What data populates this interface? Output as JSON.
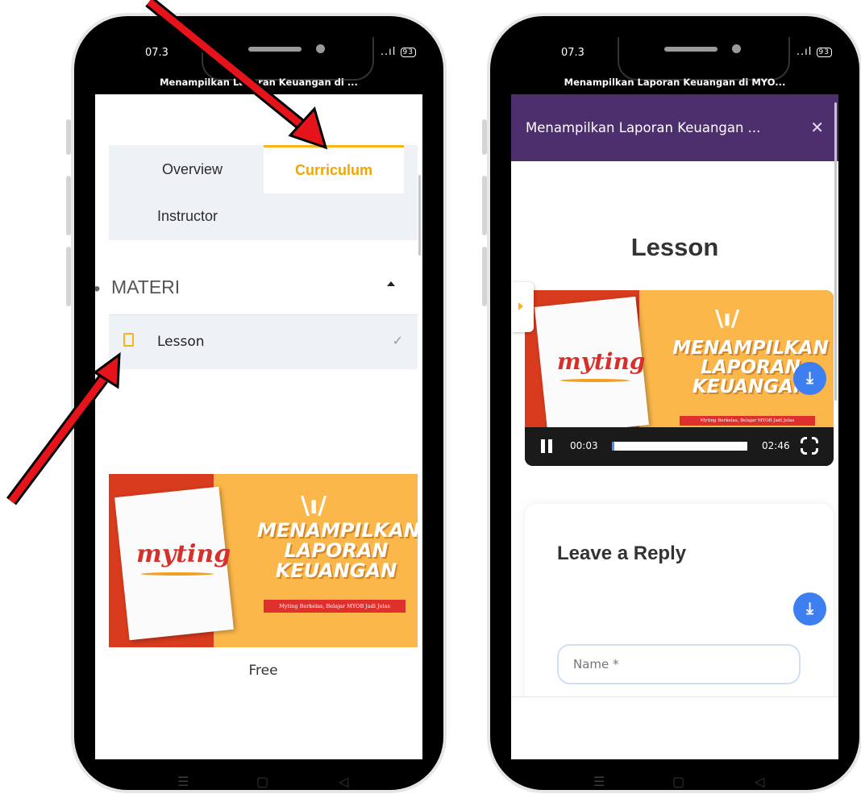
{
  "left_phone": {
    "status": {
      "time": "07.3",
      "signal": "..ıl",
      "battery": "93"
    },
    "title": "Menampilkan Laporan Keuangan di ...",
    "tabs": {
      "overview": "Overview",
      "curriculum": "Curriculum",
      "instructor": "Instructor"
    },
    "section": {
      "bullet": "•",
      "title": "MATERI"
    },
    "lesson_item": {
      "label": "Lesson",
      "check": "✓"
    },
    "banner": {
      "logo": "myting",
      "headline_1": "MENAMPILKAN",
      "headline_2": "LAPORAN",
      "headline_3": "KEUANGAN",
      "rays": "\\ı/",
      "tagline": "Myting Berkelas, Belajar MYOB Jadi Jelas"
    },
    "price": "Free",
    "nav": {
      "menu": "☰",
      "home": "▢",
      "back": "◁"
    }
  },
  "right_phone": {
    "status": {
      "time": "07.3",
      "signal": "..ıl",
      "battery": "93"
    },
    "title": "Menampilkan Laporan Keuangan di MYO...",
    "header_title": "Menampilkan Laporan Keuangan ...",
    "close": "✕",
    "lesson_heading": "Lesson",
    "banner": {
      "logo": "myting",
      "headline_1": "MENAMPILKAN",
      "headline_2": "LAPORAN",
      "headline_3": "KEUANGAN",
      "rays": "\\ı/",
      "tagline": "Myting Berkelas, Belajar MYOB Jadi Jelas"
    },
    "player": {
      "current_time": "00:03",
      "duration": "02:46",
      "progress": 0.02
    },
    "download_icon": "⤓",
    "reply": {
      "heading": "Leave a Reply",
      "name_placeholder": "Name *"
    },
    "nav": {
      "menu": "☰",
      "home": "▢",
      "back": "◁"
    }
  },
  "colors": {
    "accent": "#f6b41a",
    "header_purple": "#4d2f6e",
    "button_blue": "#3d7ff0",
    "arrow_red": "#e5141b"
  }
}
